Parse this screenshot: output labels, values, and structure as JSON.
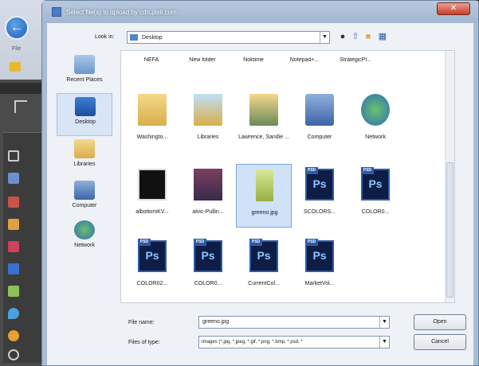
{
  "dialog": {
    "title": "Select file(s) to upload by cdn.pixlr.com",
    "close_label": "✕"
  },
  "background_app": {
    "file_label": "File"
  },
  "lookin": {
    "label": "Look in:",
    "value": "Desktop"
  },
  "places": [
    {
      "label": "Recent Places",
      "icon": "recent-places-icon"
    },
    {
      "label": "Desktop",
      "icon": "desktop-icon"
    },
    {
      "label": "Libraries",
      "icon": "libraries-icon"
    },
    {
      "label": "Computer",
      "icon": "computer-icon"
    },
    {
      "label": "Network",
      "icon": "network-icon"
    }
  ],
  "top_row": [
    "NEFA",
    "New folder",
    "Noktime",
    "Notepad+...",
    "StrategicPl..."
  ],
  "items": [
    {
      "label": "Washingto...",
      "icon": "folder-icon"
    },
    {
      "label": "Libraries",
      "icon": "libraries-icon"
    },
    {
      "label": "Lawrence, Sandie ...",
      "icon": "user-folder-icon"
    },
    {
      "label": "Computer",
      "icon": "computer-icon"
    },
    {
      "label": "Network",
      "icon": "network-icon"
    },
    {
      "label": "albottomKV...",
      "icon": "image-file-icon"
    },
    {
      "label": "alvic-Pullin...",
      "icon": "image-file-icon"
    },
    {
      "label": "greeno.jpg",
      "icon": "image-file-icon"
    },
    {
      "label": "SCOLORS...",
      "icon": "psd-icon",
      "glyph": "Ps",
      "flag": "PSD"
    },
    {
      "label": "COLOR0...",
      "icon": "psd-icon",
      "glyph": "Ps",
      "flag": "PSD"
    },
    {
      "label": "COLOR02...",
      "icon": "psd-icon",
      "glyph": "Ps",
      "flag": "PSD"
    },
    {
      "label": "COLOR0...",
      "icon": "psd-icon",
      "glyph": "Ps",
      "flag": "PSD"
    },
    {
      "label": "CurrentCol...",
      "icon": "psd-icon",
      "glyph": "Ps",
      "flag": "PSD"
    },
    {
      "label": "MarketVol...",
      "icon": "psd-icon",
      "glyph": "Ps",
      "flag": "PSD"
    }
  ],
  "filename": {
    "label": "File name:",
    "value": "greeno.jpg"
  },
  "filetype": {
    "label": "Files of type:",
    "value": "Images (*.jpg, *.jpeg, *.gif, *.png, *.bmp, *.psd, *"
  },
  "buttons": {
    "open": "Open",
    "cancel": "Cancel"
  },
  "colors": {
    "titlebar": "#a3b7d1",
    "selection": "#cfe2f7",
    "close": "#c83c2a",
    "psd": "#0d1d45"
  }
}
